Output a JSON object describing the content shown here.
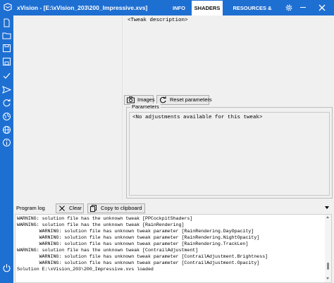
{
  "window": {
    "title": "xVision - [E:\\xVision_203\\200_Impressive.xvs]",
    "accent_color": "#1e6fd2"
  },
  "tabs": [
    {
      "label": "INFO",
      "active": false
    },
    {
      "label": "SHADERS",
      "active": true
    },
    {
      "label": "RESOURCES & SCRIPTS",
      "active": false
    }
  ],
  "left_toolbar": {
    "icons": [
      "new-file-icon",
      "open-folder-icon",
      "save-icon",
      "save-as-icon",
      "check-icon",
      "send-icon",
      "refresh-icon",
      "globe-alt-icon",
      "globe-icon",
      "info-icon",
      "power-icon"
    ]
  },
  "shaders": {
    "description": "<Tweak description>",
    "images_label": "Images",
    "reset_label": "Reset parameters",
    "parameters_title": "Parameters",
    "parameters_empty": "<No adjustments available for this tweak>"
  },
  "log": {
    "title": "Program log",
    "clear_label": "Clear",
    "copy_label": "Copy to clipboard",
    "lines": [
      "WARNING: solution file has the unknown tweak [PPCockpitShaders]",
      "WARNING: solution file has the unknown tweak [RainRendering]",
      "        WARNING: solution file has unknown tweak parameter [RainRendering.DayOpacity]",
      "        WARNING: solution file has unknown tweak parameter [RainRendering.NightOpacity]",
      "        WARNING: solution file has unknown tweak parameter [RainRendering.TrackLen]",
      "WARNING: solution file has the unknown tweak [ContrailAdjustment]",
      "        WARNING: solution file has unknown tweak parameter [ContrailAdjustment.Brightness]",
      "        WARNING: solution file has unknown tweak parameter [ContrailAdjustment.Opacity]",
      "Solution E:\\xVision_203\\200_Impressive.xvs loaded"
    ]
  }
}
